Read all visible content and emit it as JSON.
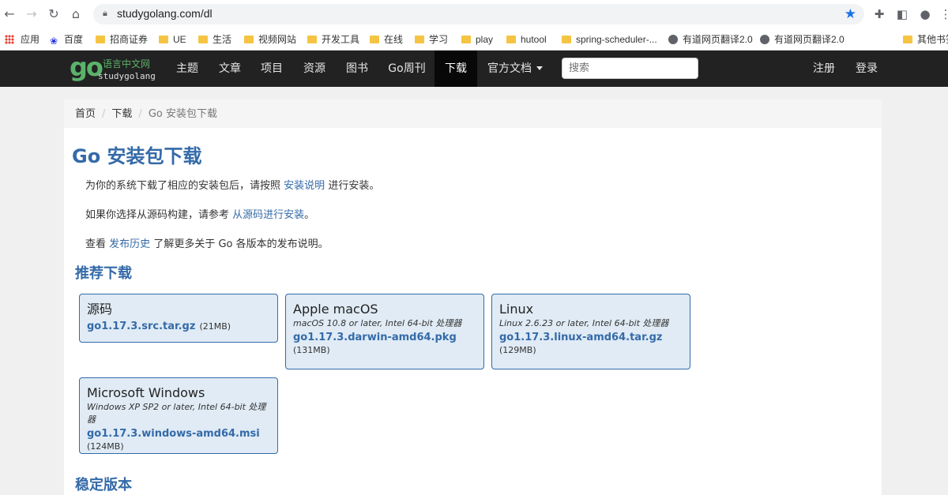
{
  "browser": {
    "url": "studygolang.com/dl",
    "bookmarks": [
      "应用",
      "百度",
      "招商证券",
      "UE",
      "生活",
      "视频网站",
      "开发工具",
      "在线",
      "学习",
      "play",
      "hutool",
      "spring-scheduler-...",
      "有道网页翻译2.0",
      "有道网页翻译2.0",
      "其他书签"
    ]
  },
  "site": {
    "logo_cn": "语言中文网",
    "logo_en": "studygolang",
    "nav": [
      "主题",
      "文章",
      "项目",
      "资源",
      "图书",
      "Go周刊",
      "下载",
      "官方文档"
    ],
    "search_placeholder": "搜索",
    "register": "注册",
    "login": "登录"
  },
  "breadcrumb": [
    "首页",
    "下载",
    "Go 安装包下载"
  ],
  "page": {
    "title": "Go 安装包下载",
    "para1_pre": "为你的系统下载了相应的安装包后，请按照",
    "para1_link": "安装说明",
    "para1_post": "进行安装。",
    "para2_pre": "如果你选择从源码构建，请参考",
    "para2_link": "从源码进行安装",
    "para2_post": "。",
    "para3_pre": "查看",
    "para3_link": "发布历史",
    "para3_post": "了解更多关于 Go 各版本的发布说明。",
    "recommended_title": "推荐下载",
    "stable_title": "稳定版本"
  },
  "downloads": [
    {
      "os": "源码",
      "req": "",
      "file": "go1.17.3.src.tar.gz",
      "size": "(21MB)"
    },
    {
      "os": "Apple macOS",
      "req": "macOS 10.8 or later, Intel 64-bit 处理器",
      "file": "go1.17.3.darwin-amd64.pkg",
      "size": "(131MB)"
    },
    {
      "os": "Linux",
      "req": "Linux 2.6.23 or later, Intel 64-bit 处理器",
      "file": "go1.17.3.linux-amd64.tar.gz",
      "size": "(129MB)"
    },
    {
      "os": "Microsoft Windows",
      "req": "Windows XP SP2 or later, Intel 64-bit 处理器",
      "file": "go1.17.3.windows-amd64.msi",
      "size": "(124MB)"
    }
  ]
}
